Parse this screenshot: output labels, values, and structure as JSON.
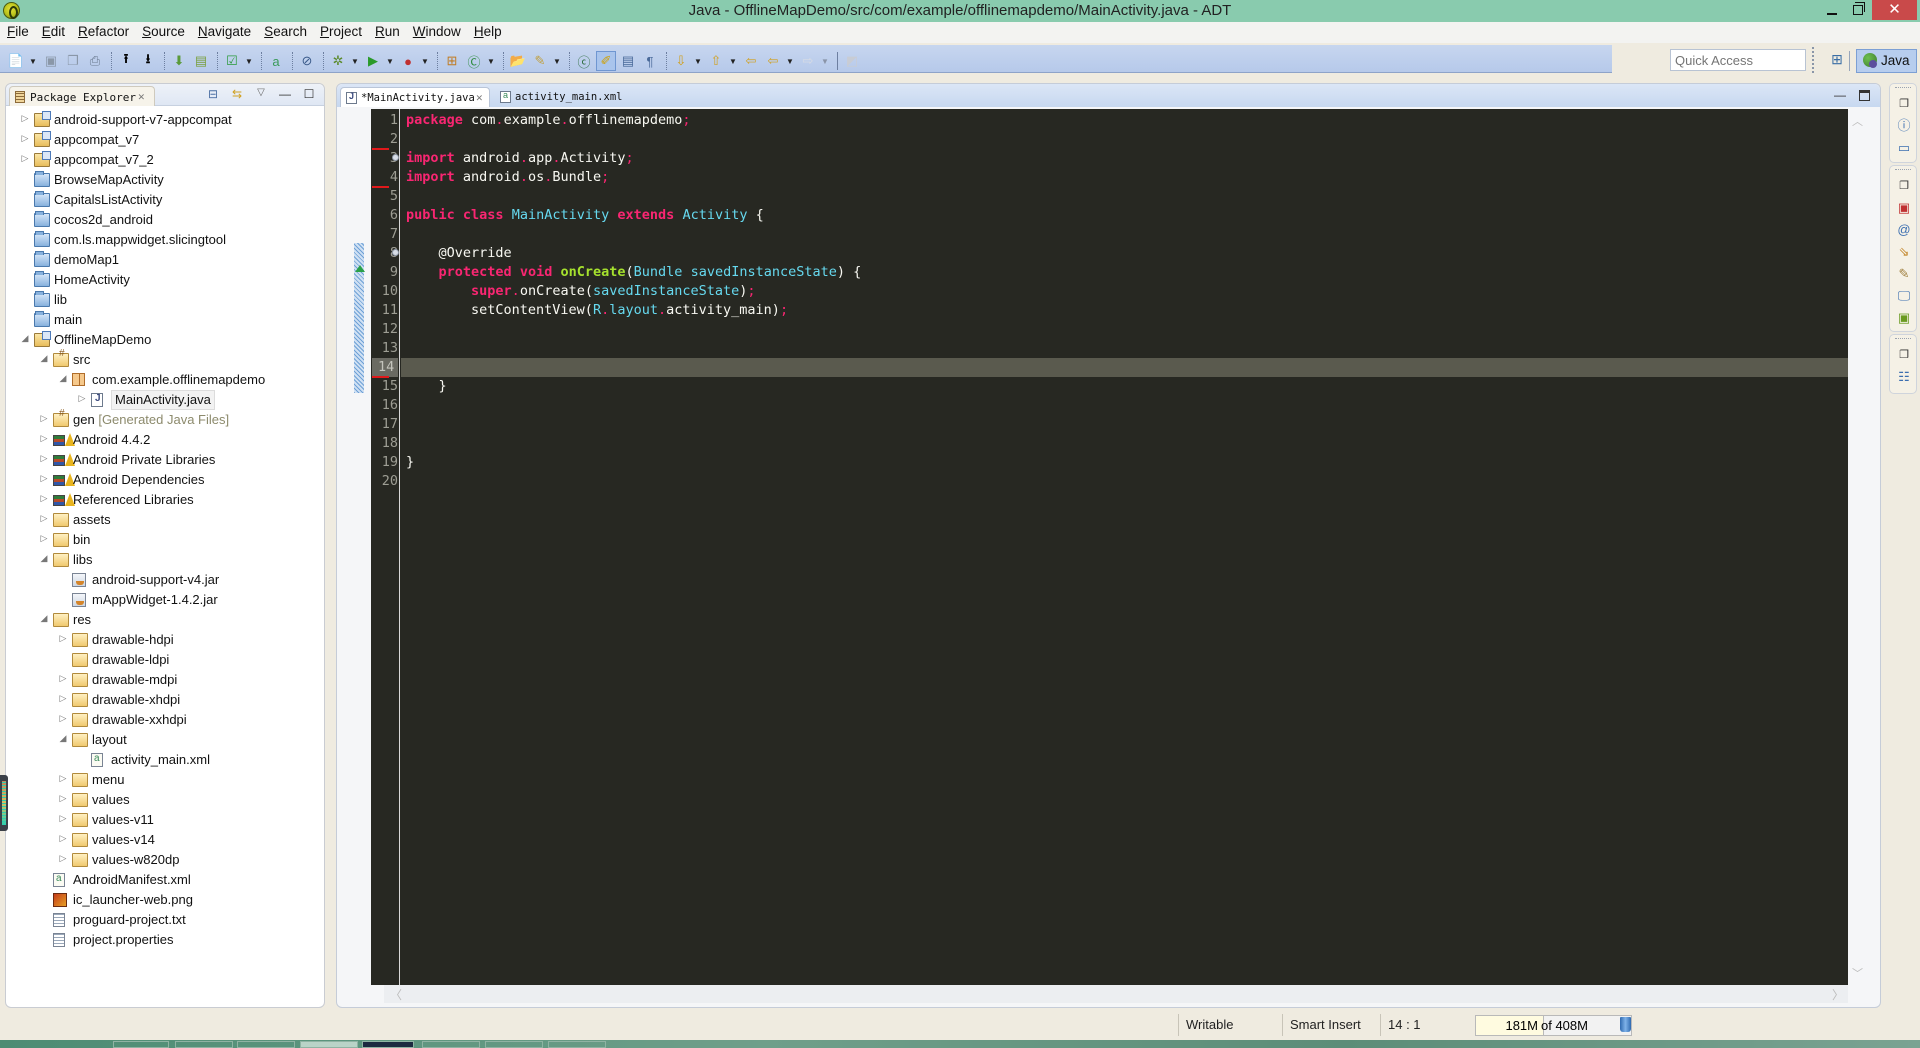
{
  "window": {
    "title": "Java - OfflineMapDemo/src/com/example/offlinemapdemo/MainActivity.java - ADT",
    "close_glyph": "✕"
  },
  "menu": [
    "File",
    "Edit",
    "Refactor",
    "Source",
    "Navigate",
    "Search",
    "Project",
    "Run",
    "Window",
    "Help"
  ],
  "toolbar": {
    "quick_access_placeholder": "Quick Access",
    "perspective_label": "Java",
    "buttons": [
      "new",
      "save",
      "save-all",
      "print",
      "upload",
      "download",
      "android-sdk-manager",
      "android-avd-manager",
      "lint-check",
      "new-android-xml",
      "skip-breakpoints",
      "debug",
      "run",
      "external-tools",
      "new-java-package",
      "new-java-class",
      "open-type",
      "search",
      "open-task",
      "toggle-mark-occurrences",
      "show-whitespace",
      "show-block",
      "next-annotation",
      "previous-annotation",
      "last-edit-location",
      "back",
      "forward",
      "pin-editor"
    ]
  },
  "package_explorer": {
    "tab_label": "Package Explorer",
    "tree": [
      {
        "label": "android-support-v7-appcompat",
        "icon": "project",
        "depth": 0,
        "twisty": "collapsed"
      },
      {
        "label": "appcompat_v7",
        "icon": "project",
        "depth": 0,
        "twisty": "collapsed"
      },
      {
        "label": "appcompat_v7_2",
        "icon": "project",
        "depth": 0,
        "twisty": "collapsed"
      },
      {
        "label": "BrowseMapActivity",
        "icon": "closed",
        "depth": 0,
        "twisty": "none"
      },
      {
        "label": "CapitalsListActivity",
        "icon": "closed",
        "depth": 0,
        "twisty": "none"
      },
      {
        "label": "cocos2d_android",
        "icon": "closed",
        "depth": 0,
        "twisty": "none"
      },
      {
        "label": "com.ls.mappwidget.slicingtool",
        "icon": "closed",
        "depth": 0,
        "twisty": "none"
      },
      {
        "label": "demoMap1",
        "icon": "closed",
        "depth": 0,
        "twisty": "none"
      },
      {
        "label": "HomeActivity",
        "icon": "closed",
        "depth": 0,
        "twisty": "none"
      },
      {
        "label": "lib",
        "icon": "closed",
        "depth": 0,
        "twisty": "none"
      },
      {
        "label": "main",
        "icon": "closed",
        "depth": 0,
        "twisty": "none"
      },
      {
        "label": "OfflineMapDemo",
        "icon": "project",
        "depth": 0,
        "twisty": "expanded"
      },
      {
        "label": "src",
        "icon": "srcfolder",
        "depth": 1,
        "twisty": "expanded"
      },
      {
        "label": "com.example.offlinemapdemo",
        "icon": "package",
        "depth": 2,
        "twisty": "expanded"
      },
      {
        "label": "MainActivity.java",
        "icon": "java",
        "depth": 3,
        "twisty": "collapsed",
        "selected": true
      },
      {
        "label": "gen",
        "decoration": "[Generated Java Files]",
        "icon": "srcfolder",
        "depth": 1,
        "twisty": "collapsed"
      },
      {
        "label": "Android 4.4.2",
        "icon": "lib",
        "depth": 1,
        "twisty": "collapsed"
      },
      {
        "label": "Android Private Libraries",
        "icon": "lib",
        "depth": 1,
        "twisty": "collapsed"
      },
      {
        "label": "Android Dependencies",
        "icon": "lib",
        "depth": 1,
        "twisty": "collapsed"
      },
      {
        "label": "Referenced Libraries",
        "icon": "lib",
        "depth": 1,
        "twisty": "collapsed"
      },
      {
        "label": "assets",
        "icon": "folder",
        "depth": 1,
        "twisty": "collapsed"
      },
      {
        "label": "bin",
        "icon": "folder",
        "depth": 1,
        "twisty": "collapsed"
      },
      {
        "label": "libs",
        "icon": "folder",
        "depth": 1,
        "twisty": "expanded"
      },
      {
        "label": "android-support-v4.jar",
        "icon": "jar",
        "depth": 2,
        "twisty": "none"
      },
      {
        "label": "mAppWidget-1.4.2.jar",
        "icon": "jar",
        "depth": 2,
        "twisty": "none"
      },
      {
        "label": "res",
        "icon": "folder",
        "depth": 1,
        "twisty": "expanded"
      },
      {
        "label": "drawable-hdpi",
        "icon": "folder",
        "depth": 2,
        "twisty": "collapsed"
      },
      {
        "label": "drawable-ldpi",
        "icon": "folder",
        "depth": 2,
        "twisty": "none"
      },
      {
        "label": "drawable-mdpi",
        "icon": "folder",
        "depth": 2,
        "twisty": "collapsed"
      },
      {
        "label": "drawable-xhdpi",
        "icon": "folder",
        "depth": 2,
        "twisty": "collapsed"
      },
      {
        "label": "drawable-xxhdpi",
        "icon": "folder",
        "depth": 2,
        "twisty": "collapsed"
      },
      {
        "label": "layout",
        "icon": "folder",
        "depth": 2,
        "twisty": "expanded"
      },
      {
        "label": "activity_main.xml",
        "icon": "xml",
        "depth": 3,
        "twisty": "none"
      },
      {
        "label": "menu",
        "icon": "folder",
        "depth": 2,
        "twisty": "collapsed"
      },
      {
        "label": "values",
        "icon": "folder",
        "depth": 2,
        "twisty": "collapsed"
      },
      {
        "label": "values-v11",
        "icon": "folder",
        "depth": 2,
        "twisty": "collapsed"
      },
      {
        "label": "values-v14",
        "icon": "folder",
        "depth": 2,
        "twisty": "collapsed"
      },
      {
        "label": "values-w820dp",
        "icon": "folder",
        "depth": 2,
        "twisty": "collapsed"
      },
      {
        "label": "AndroidManifest.xml",
        "icon": "xml",
        "depth": 1,
        "twisty": "none"
      },
      {
        "label": "ic_launcher-web.png",
        "icon": "png",
        "depth": 1,
        "twisty": "none"
      },
      {
        "label": "proguard-project.txt",
        "icon": "txt",
        "depth": 1,
        "twisty": "none"
      },
      {
        "label": "project.properties",
        "icon": "txt",
        "depth": 1,
        "twisty": "none"
      }
    ]
  },
  "editor": {
    "tabs": [
      {
        "label": "*MainActivity.java",
        "active": true
      },
      {
        "label": "activity_main.xml",
        "active": false
      }
    ],
    "current_line": 14,
    "lines": [
      [
        [
          "kw",
          "package"
        ],
        [
          "plain",
          " com"
        ],
        [
          "punc",
          "."
        ],
        [
          "plain",
          "example"
        ],
        [
          "punc",
          "."
        ],
        [
          "plain",
          "offlinemapdemo"
        ],
        [
          "punc",
          ";"
        ]
      ],
      [],
      [
        [
          "kw",
          "import"
        ],
        [
          "plain",
          " android"
        ],
        [
          "punc",
          "."
        ],
        [
          "plain",
          "app"
        ],
        [
          "punc",
          "."
        ],
        [
          "plain",
          "Activity"
        ],
        [
          "punc",
          ";"
        ]
      ],
      [
        [
          "kw",
          "import"
        ],
        [
          "plain",
          " android"
        ],
        [
          "punc",
          "."
        ],
        [
          "plain",
          "os"
        ],
        [
          "punc",
          "."
        ],
        [
          "plain",
          "Bundle"
        ],
        [
          "punc",
          ";"
        ]
      ],
      [],
      [
        [
          "kw",
          "public"
        ],
        [
          "plain",
          " "
        ],
        [
          "kw",
          "class"
        ],
        [
          "plain",
          " "
        ],
        [
          "cls",
          "MainActivity"
        ],
        [
          "plain",
          " "
        ],
        [
          "kw",
          "extends"
        ],
        [
          "plain",
          " "
        ],
        [
          "cls",
          "Activity"
        ],
        [
          "plain",
          " {"
        ]
      ],
      [],
      [
        [
          "ann",
          "    @Override"
        ]
      ],
      [
        [
          "plain",
          "    "
        ],
        [
          "kw",
          "protected"
        ],
        [
          "plain",
          " "
        ],
        [
          "kw",
          "void"
        ],
        [
          "plain",
          " "
        ],
        [
          "fn",
          "onCreate"
        ],
        [
          "plain",
          "("
        ],
        [
          "cls",
          "Bundle"
        ],
        [
          "plain",
          " "
        ],
        [
          "param",
          "savedInstanceState"
        ],
        [
          "plain",
          ") {"
        ]
      ],
      [
        [
          "plain",
          "        "
        ],
        [
          "kw",
          "super"
        ],
        [
          "punc",
          "."
        ],
        [
          "plain",
          "onCreate("
        ],
        [
          "param",
          "savedInstanceState"
        ],
        [
          "plain",
          ")"
        ],
        [
          "punc",
          ";"
        ]
      ],
      [
        [
          "plain",
          "        setContentView("
        ],
        [
          "cls",
          "R"
        ],
        [
          "punc",
          "."
        ],
        [
          "cls",
          "layout"
        ],
        [
          "punc",
          "."
        ],
        [
          "plain",
          "activity_main)"
        ],
        [
          "punc",
          ";"
        ]
      ],
      [],
      [],
      [],
      [
        [
          "plain",
          "    }"
        ]
      ],
      [],
      [],
      [],
      [
        [
          "plain",
          "}"
        ]
      ],
      []
    ],
    "fold_lines": [
      3,
      8
    ],
    "error_marks_below": [
      2,
      4,
      14
    ],
    "override_marker_line": 9
  },
  "status_bar": {
    "writable": "Writable",
    "insert_mode": "Smart Insert",
    "cursor_position": "14 : 1",
    "heap_used": "181M",
    "heap_total": "of 408M",
    "heap_fraction": 0.44
  },
  "trim_stacks": [
    [
      "restore-icon",
      "help-icon",
      "view-icon"
    ],
    [
      "restore-icon",
      "problems-icon",
      "javadoc-icon",
      "declaration-icon",
      "logcat-icon",
      "console-icon",
      "android-devices-icon"
    ],
    [
      "restore-icon",
      "outline-icon"
    ]
  ]
}
